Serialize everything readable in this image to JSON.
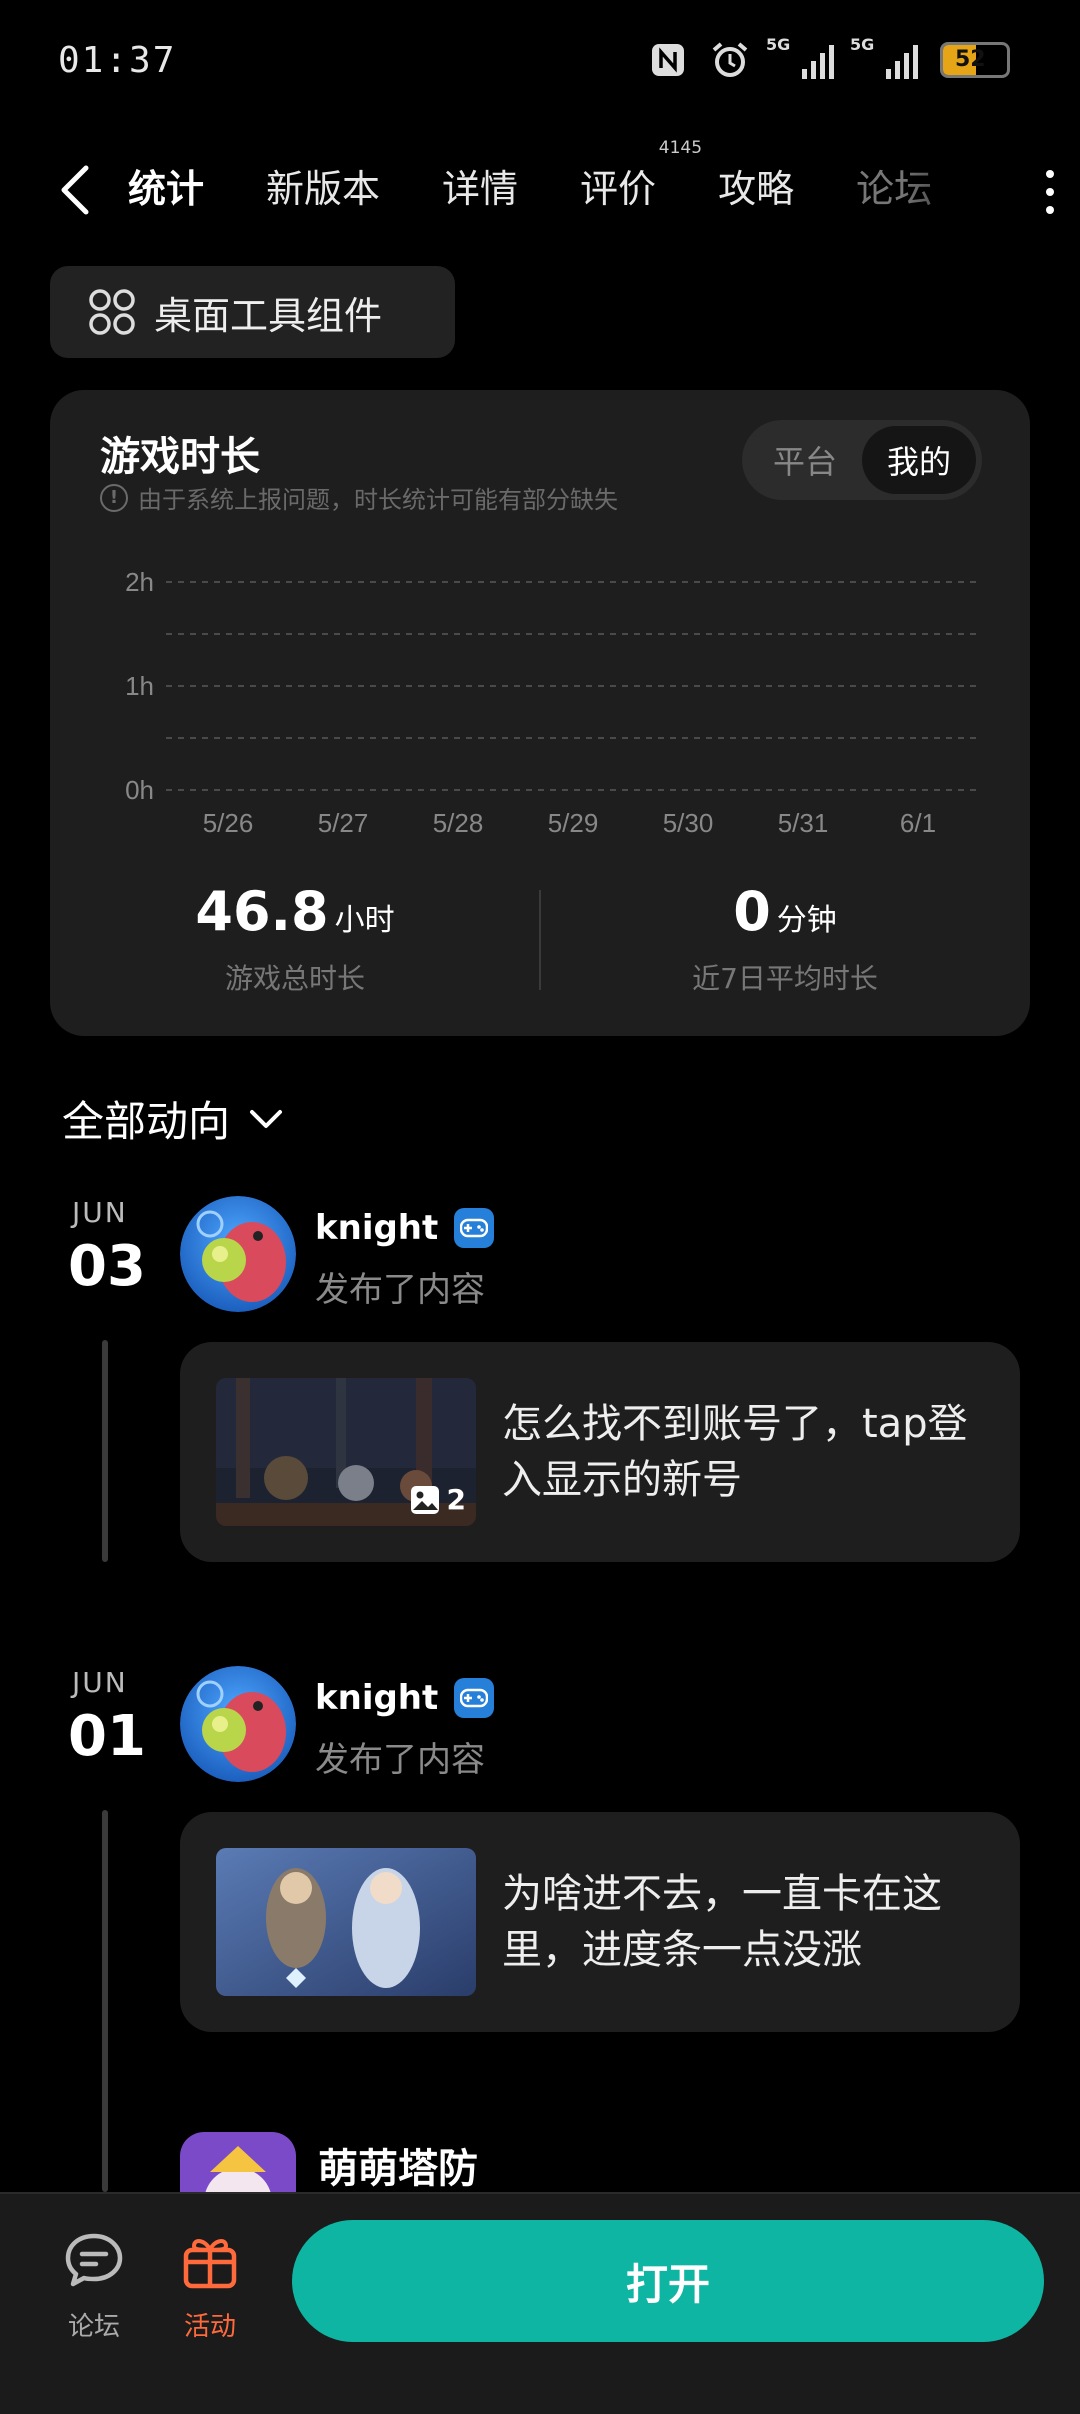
{
  "status_bar": {
    "time": "01:37",
    "sig1_label": "5G",
    "sig2_label": "5G",
    "battery": "52",
    "battery_level": 0.52
  },
  "tabs": [
    {
      "label": "统计",
      "active": true
    },
    {
      "label": "新版本"
    },
    {
      "label": "详情"
    },
    {
      "label": "评价",
      "badge": "4145"
    },
    {
      "label": "攻略"
    },
    {
      "label": "论坛"
    }
  ],
  "widget_chip": {
    "label": "桌面工具组件",
    "icon": "widgets-icon"
  },
  "stats_card": {
    "title": "游戏时长",
    "notice": "由于系统上报问题，时长统计可能有部分缺失",
    "toggle": {
      "options": [
        "平台",
        "我的"
      ],
      "selected": "我的"
    },
    "total": {
      "value": "46.8",
      "unit": "小时",
      "caption": "游戏总时长"
    },
    "average": {
      "value": "0",
      "unit": "分钟",
      "caption": "近7日平均时长"
    }
  },
  "chart_data": {
    "type": "bar",
    "categories": [
      "5/26",
      "5/27",
      "5/28",
      "5/29",
      "5/30",
      "5/31",
      "6/1"
    ],
    "series": [
      {
        "values": [
          0,
          0,
          0,
          0,
          0,
          0,
          0
        ]
      }
    ],
    "y_ticks": [
      "2h",
      "1h",
      "0h"
    ],
    "ylim": [
      0,
      2
    ],
    "grid": true
  },
  "feed": {
    "filter_label": "全部动向",
    "entries": [
      {
        "month": "JUN",
        "day": "03",
        "author": "knight",
        "action": "发布了内容",
        "text": "怎么找不到账号了，tap登入显示的新号",
        "image_count": "2"
      },
      {
        "month": "JUN",
        "day": "01",
        "author": "knight",
        "action": "发布了内容",
        "text": "为啥进不去，一直卡在这里，进度条一点没涨"
      }
    ],
    "game": {
      "title": "萌萌塔防"
    }
  },
  "bottom_bar": {
    "forum_label": "论坛",
    "activity_label": "活动",
    "open_label": "打开",
    "accent": "#0fb5a3",
    "activity_color": "#ff6a3d"
  }
}
